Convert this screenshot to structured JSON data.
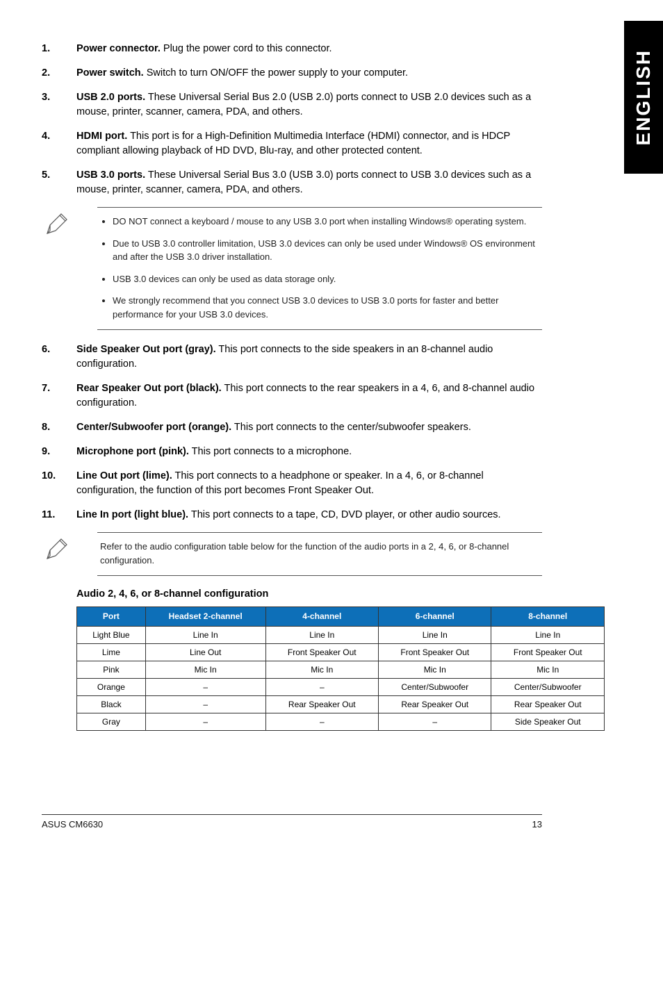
{
  "side_tab": "ENGLISH",
  "items": [
    {
      "num": "1.",
      "label": "Power connector.",
      "text": " Plug the power cord to this connector."
    },
    {
      "num": "2.",
      "label": "Power switch.",
      "text": " Switch to turn ON/OFF the power supply to your computer."
    },
    {
      "num": "3.",
      "label": "USB 2.0 ports.",
      "text": " These Universal Serial Bus 2.0 (USB 2.0) ports connect to USB 2.0 devices such as a mouse, printer, scanner, camera, PDA, and others."
    },
    {
      "num": "4.",
      "label": "HDMI port.",
      "text": " This port is for a High-Definition Multimedia Interface (HDMI) connector, and is HDCP compliant allowing playback of HD DVD, Blu-ray, and other protected content."
    },
    {
      "num": "5.",
      "label": "USB 3.0 ports.",
      "text": " These Universal Serial Bus 3.0 (USB 3.0) ports connect to USB 3.0 devices such as a mouse, printer, scanner, camera, PDA, and others."
    }
  ],
  "note1": [
    "DO NOT connect a keyboard / mouse to any USB 3.0 port when installing Windows® operating system.",
    "Due to USB 3.0 controller limitation, USB 3.0 devices can only be used under Windows® OS environment and after the USB 3.0 driver installation.",
    "USB 3.0 devices can only be used as data storage only.",
    "We strongly recommend that you connect USB 3.0 devices to USB 3.0 ports for faster and better performance for your USB 3.0 devices."
  ],
  "items2": [
    {
      "num": "6.",
      "label": "Side Speaker Out port (gray).",
      "text": " This port connects to the side speakers in an 8-channel audio configuration."
    },
    {
      "num": "7.",
      "label": "Rear Speaker Out port (black).",
      "text": " This port connects to the rear speakers in a 4, 6, and 8-channel audio configuration."
    },
    {
      "num": "8.",
      "label": "Center/Subwoofer port (orange).",
      "text": " This port connects to the center/subwoofer speakers."
    },
    {
      "num": "9.",
      "label": "Microphone port (pink).",
      "text": " This port connects to a microphone."
    },
    {
      "num": "10.",
      "label": "Line Out port (lime).",
      "text": " This port connects to a headphone or speaker. In a 4, 6, or 8-channel configuration, the function of this port becomes Front Speaker Out."
    },
    {
      "num": "11.",
      "label": "Line In port (light blue).",
      "text": " This port connects to a tape, CD, DVD player, or other audio sources."
    }
  ],
  "note2": "Refer to the audio configuration table below for the function of the audio ports in a 2, 4, 6, or 8-channel configuration.",
  "table_title": "Audio 2, 4, 6, or 8-channel configuration",
  "table": {
    "headers": [
      "Port",
      "Headset 2-channel",
      "4-channel",
      "6-channel",
      "8-channel"
    ],
    "rows": [
      [
        "Light Blue",
        "Line In",
        "Line In",
        "Line In",
        "Line In"
      ],
      [
        "Lime",
        "Line Out",
        "Front Speaker Out",
        "Front Speaker Out",
        "Front Speaker Out"
      ],
      [
        "Pink",
        "Mic In",
        "Mic In",
        "Mic In",
        "Mic In"
      ],
      [
        "Orange",
        "–",
        "–",
        "Center/Subwoofer",
        "Center/Subwoofer"
      ],
      [
        "Black",
        "–",
        "Rear Speaker Out",
        "Rear Speaker Out",
        "Rear Speaker Out"
      ],
      [
        "Gray",
        "–",
        "–",
        "–",
        "Side Speaker Out"
      ]
    ]
  },
  "footer": {
    "left": "ASUS CM6630",
    "right": "13"
  }
}
